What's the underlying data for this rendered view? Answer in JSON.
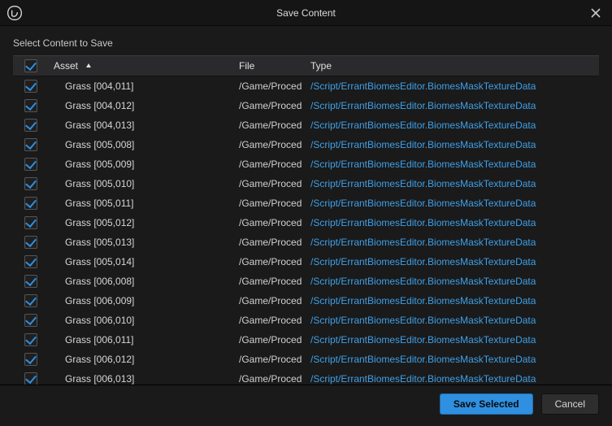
{
  "window": {
    "title": "Save Content"
  },
  "subtitle": "Select Content to Save",
  "columns": {
    "asset": "Asset",
    "file": "File",
    "type": "Type"
  },
  "rows": [
    {
      "checked": true,
      "asset": "Grass [004,011]",
      "file": "/Game/Proced",
      "type": "/Script/ErrantBiomesEditor.BiomesMaskTextureData"
    },
    {
      "checked": true,
      "asset": "Grass [004,012]",
      "file": "/Game/Proced",
      "type": "/Script/ErrantBiomesEditor.BiomesMaskTextureData"
    },
    {
      "checked": true,
      "asset": "Grass [004,013]",
      "file": "/Game/Proced",
      "type": "/Script/ErrantBiomesEditor.BiomesMaskTextureData"
    },
    {
      "checked": true,
      "asset": "Grass [005,008]",
      "file": "/Game/Proced",
      "type": "/Script/ErrantBiomesEditor.BiomesMaskTextureData"
    },
    {
      "checked": true,
      "asset": "Grass [005,009]",
      "file": "/Game/Proced",
      "type": "/Script/ErrantBiomesEditor.BiomesMaskTextureData"
    },
    {
      "checked": true,
      "asset": "Grass [005,010]",
      "file": "/Game/Proced",
      "type": "/Script/ErrantBiomesEditor.BiomesMaskTextureData"
    },
    {
      "checked": true,
      "asset": "Grass [005,011]",
      "file": "/Game/Proced",
      "type": "/Script/ErrantBiomesEditor.BiomesMaskTextureData"
    },
    {
      "checked": true,
      "asset": "Grass [005,012]",
      "file": "/Game/Proced",
      "type": "/Script/ErrantBiomesEditor.BiomesMaskTextureData"
    },
    {
      "checked": true,
      "asset": "Grass [005,013]",
      "file": "/Game/Proced",
      "type": "/Script/ErrantBiomesEditor.BiomesMaskTextureData"
    },
    {
      "checked": true,
      "asset": "Grass [005,014]",
      "file": "/Game/Proced",
      "type": "/Script/ErrantBiomesEditor.BiomesMaskTextureData"
    },
    {
      "checked": true,
      "asset": "Grass [006,008]",
      "file": "/Game/Proced",
      "type": "/Script/ErrantBiomesEditor.BiomesMaskTextureData"
    },
    {
      "checked": true,
      "asset": "Grass [006,009]",
      "file": "/Game/Proced",
      "type": "/Script/ErrantBiomesEditor.BiomesMaskTextureData"
    },
    {
      "checked": true,
      "asset": "Grass [006,010]",
      "file": "/Game/Proced",
      "type": "/Script/ErrantBiomesEditor.BiomesMaskTextureData"
    },
    {
      "checked": true,
      "asset": "Grass [006,011]",
      "file": "/Game/Proced",
      "type": "/Script/ErrantBiomesEditor.BiomesMaskTextureData"
    },
    {
      "checked": true,
      "asset": "Grass [006,012]",
      "file": "/Game/Proced",
      "type": "/Script/ErrantBiomesEditor.BiomesMaskTextureData"
    },
    {
      "checked": true,
      "asset": "Grass [006,013]",
      "file": "/Game/Proced",
      "type": "/Script/ErrantBiomesEditor.BiomesMaskTextureData"
    }
  ],
  "footer": {
    "save": "Save Selected",
    "cancel": "Cancel"
  }
}
